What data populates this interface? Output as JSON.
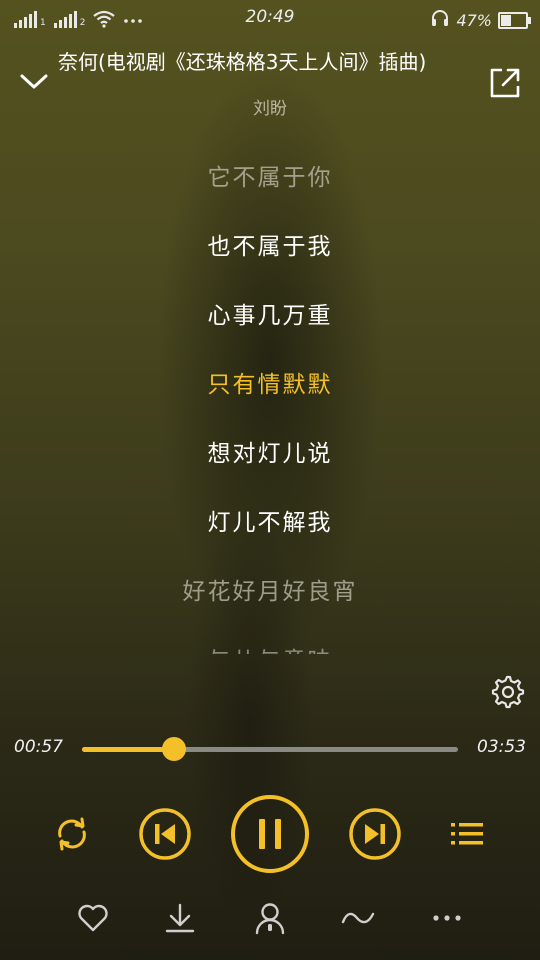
{
  "status_bar": {
    "signal_sim1_label": "1",
    "signal_sim2_label": "2",
    "time": "20:49",
    "battery_percent_text": "47%",
    "battery_level": 0.47,
    "icons": [
      "signal-icon",
      "signal-icon",
      "wifi-icon",
      "more-status-icon",
      "headset-icon",
      "battery-icon"
    ]
  },
  "header": {
    "song_title": "奈何(电视剧《还珠格格3天上人间》插曲)",
    "artist": "刘盼",
    "collapse_icon": "chevron-down-icon",
    "share_icon": "share-icon"
  },
  "lyrics": {
    "lines": [
      {
        "text": "它不属于你",
        "state": "dim"
      },
      {
        "text": "也不属于我",
        "state": "normal"
      },
      {
        "text": "心事几万重",
        "state": "normal"
      },
      {
        "text": "只有情默默",
        "state": "active"
      },
      {
        "text": "想对灯儿说",
        "state": "normal"
      },
      {
        "text": "灯儿不解我",
        "state": "normal"
      },
      {
        "text": "好花好月好良宵",
        "state": "dim"
      },
      {
        "text": "与儿与意味",
        "state": "faded"
      }
    ]
  },
  "player": {
    "elapsed": "00:57",
    "total": "03:53",
    "progress": 0.245
  },
  "controls": {
    "items": [
      "repeat-icon",
      "previous-icon",
      "pause-icon",
      "next-icon",
      "playlist-icon"
    ]
  },
  "actions": {
    "items": [
      "heart-icon",
      "download-icon",
      "singer-icon",
      "effect-icon",
      "more-icon"
    ]
  },
  "colors": {
    "accent": "#f4c02a",
    "text": "#ffffff",
    "track": "#8a8a84"
  }
}
